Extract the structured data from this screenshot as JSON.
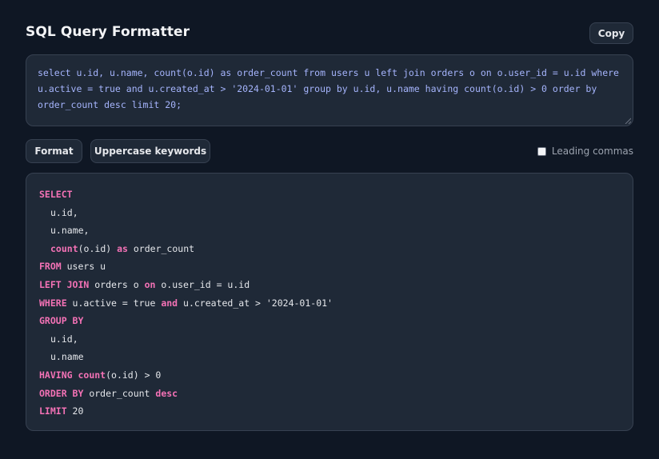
{
  "header": {
    "title": "SQL Query Formatter",
    "copy_label": "Copy"
  },
  "input": {
    "value": "select u.id, u.name, count(o.id) as order_count from users u left join orders o on o.user_id = u.id where u.active = true and u.created_at > '2024-01-01' group by u.id, u.name having count(o.id) > 0 order by order_count desc limit 20;",
    "lines": [
      "select u.id, u.name, count(o.id) as order_count from users u left join orders o on o.user_id = u.id where",
      "u.active = true and u.created_at > '2024-01-01' group by u.id, u.name having count(o.id) > 0 order by",
      "order_count desc limit 20;"
    ]
  },
  "toolbar": {
    "format_label": "Format",
    "uppercase_label": "Uppercase keywords",
    "leading_commas_label": "Leading commas",
    "leading_commas_checked": false
  },
  "output": {
    "lines": [
      {
        "indent": false,
        "tokens": [
          {
            "t": "SELECT",
            "kw": true
          }
        ]
      },
      {
        "indent": true,
        "tokens": [
          {
            "t": "u.id,",
            "kw": false
          }
        ]
      },
      {
        "indent": true,
        "tokens": [
          {
            "t": "u.name,",
            "kw": false
          }
        ]
      },
      {
        "indent": true,
        "tokens": [
          {
            "t": "count",
            "kw": true
          },
          {
            "t": "(o.id) ",
            "kw": false
          },
          {
            "t": "as",
            "kw": true
          },
          {
            "t": " order_count",
            "kw": false
          }
        ]
      },
      {
        "indent": false,
        "tokens": [
          {
            "t": "FROM",
            "kw": true
          },
          {
            "t": " users u",
            "kw": false
          }
        ]
      },
      {
        "indent": false,
        "tokens": [
          {
            "t": "LEFT JOIN",
            "kw": true
          },
          {
            "t": " orders o ",
            "kw": false
          },
          {
            "t": "on",
            "kw": true
          },
          {
            "t": " o.user_id = u.id",
            "kw": false
          }
        ]
      },
      {
        "indent": false,
        "tokens": [
          {
            "t": "WHERE",
            "kw": true
          },
          {
            "t": " u.active = true ",
            "kw": false
          },
          {
            "t": "and",
            "kw": true
          },
          {
            "t": " u.created_at > '2024-01-01'",
            "kw": false
          }
        ]
      },
      {
        "indent": false,
        "tokens": [
          {
            "t": "GROUP BY",
            "kw": true
          }
        ]
      },
      {
        "indent": true,
        "tokens": [
          {
            "t": "u.id,",
            "kw": false
          }
        ]
      },
      {
        "indent": true,
        "tokens": [
          {
            "t": "u.name",
            "kw": false
          }
        ]
      },
      {
        "indent": false,
        "tokens": [
          {
            "t": "HAVING",
            "kw": true
          },
          {
            "t": " ",
            "kw": false
          },
          {
            "t": "count",
            "kw": true
          },
          {
            "t": "(o.id) > 0",
            "kw": false
          }
        ]
      },
      {
        "indent": false,
        "tokens": [
          {
            "t": "ORDER BY",
            "kw": true
          },
          {
            "t": " order_count ",
            "kw": false
          },
          {
            "t": "desc",
            "kw": true
          }
        ]
      },
      {
        "indent": false,
        "tokens": [
          {
            "t": "LIMIT",
            "kw": true
          },
          {
            "t": " 20",
            "kw": false
          }
        ]
      }
    ]
  },
  "colors": {
    "background": "#0f1724",
    "panel": "#1f2937",
    "keyword": "#f472b6",
    "input_text": "#a5b4fc"
  }
}
